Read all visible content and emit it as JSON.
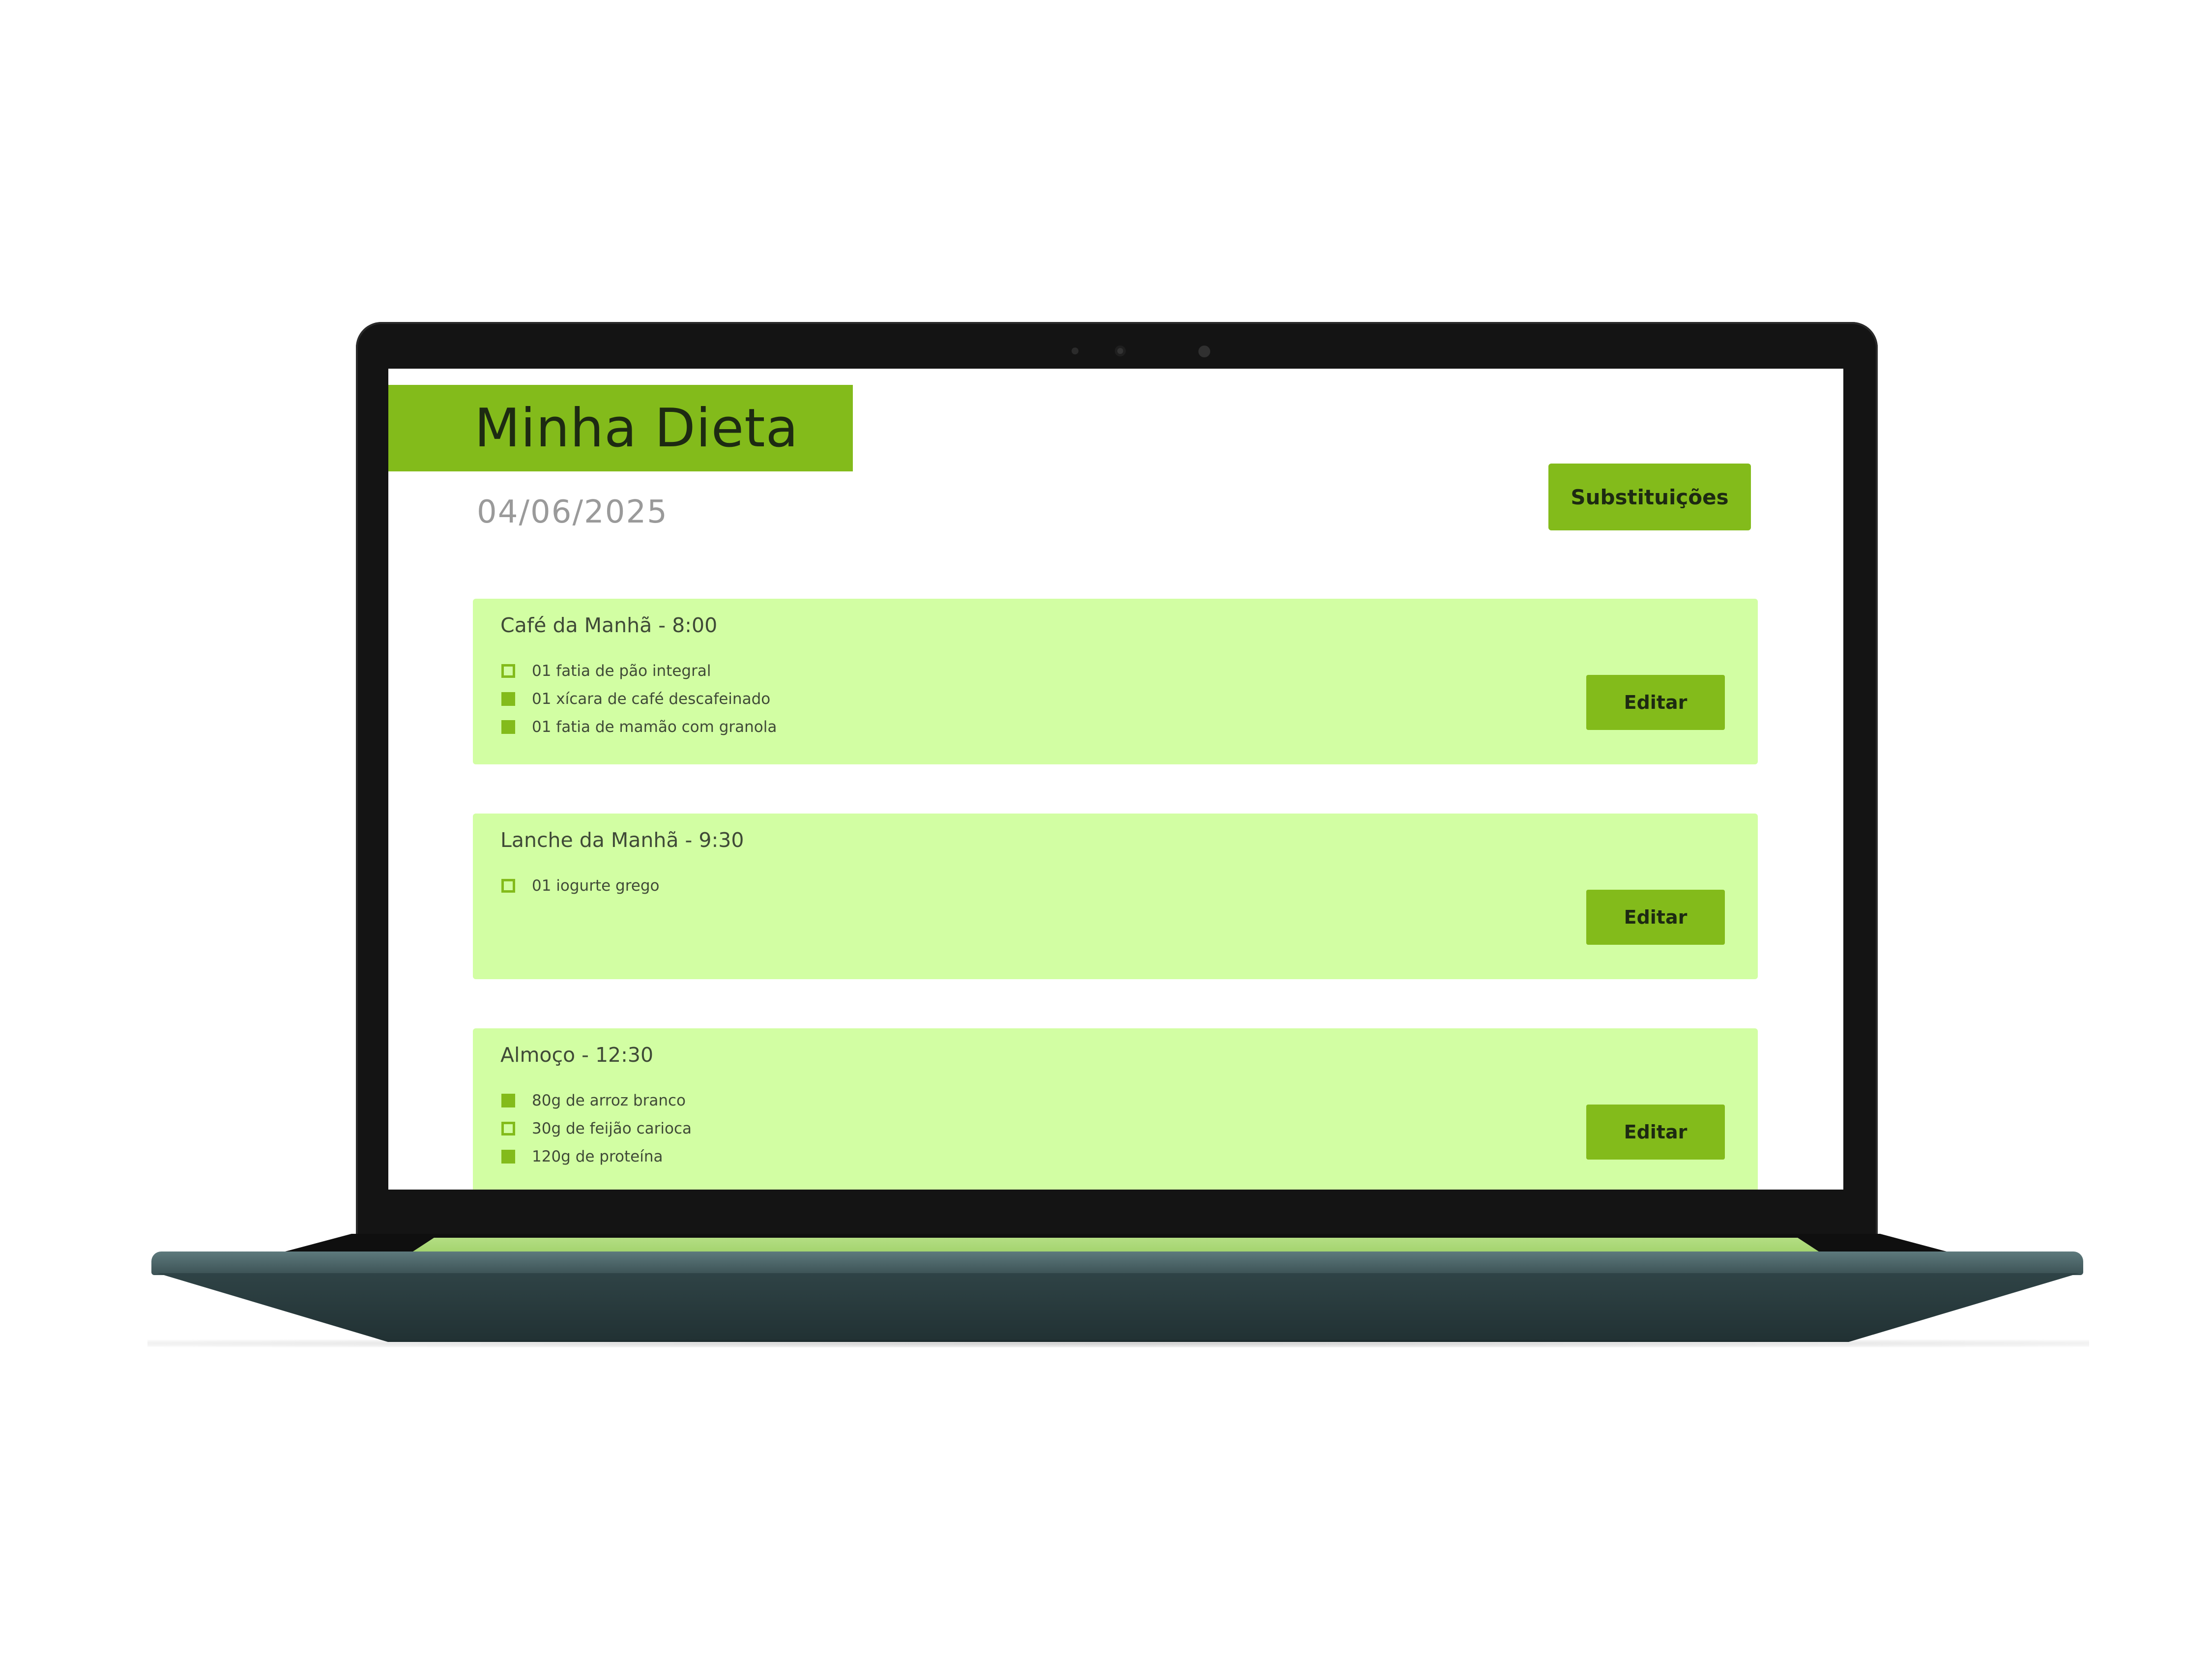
{
  "app": {
    "title": "Minha Dieta",
    "date": "04/06/2025",
    "substitutions_label": "Substituições"
  },
  "meals": [
    {
      "title": "Café da Manhã - 8:00",
      "edit_label": "Editar",
      "items": [
        {
          "label": "01 fatia de pão integral",
          "checked": false
        },
        {
          "label": "01 xícara de café descafeinado",
          "checked": true
        },
        {
          "label": "01 fatia de mamão com granola",
          "checked": true
        }
      ]
    },
    {
      "title": "Lanche da Manhã - 9:30",
      "edit_label": "Editar",
      "items": [
        {
          "label": "01 iogurte grego",
          "checked": false
        }
      ]
    },
    {
      "title": "Almoço - 12:30",
      "edit_label": "Editar",
      "items": [
        {
          "label": "80g de arroz branco",
          "checked": true
        },
        {
          "label": "30g de feijão carioca",
          "checked": false
        },
        {
          "label": "120g de proteína",
          "checked": true
        }
      ]
    }
  ],
  "colors": {
    "accent": "#83bb1b",
    "card_background": "#d2fea3",
    "text_dark": "#1d2a12",
    "date_gray": "#9a9a9a"
  }
}
